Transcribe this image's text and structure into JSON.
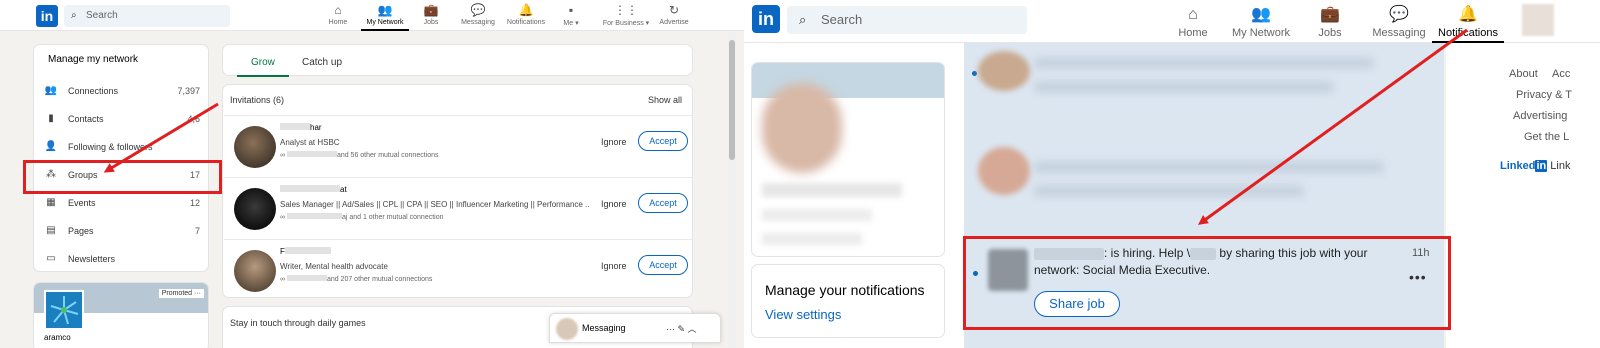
{
  "left": {
    "nav": {
      "logo": "in",
      "search_placeholder": "Search",
      "items": [
        {
          "label": "Home",
          "icon": "home-icon",
          "glyph": "⌂"
        },
        {
          "label": "My Network",
          "icon": "network-icon",
          "glyph": "👥"
        },
        {
          "label": "Jobs",
          "icon": "briefcase-icon",
          "glyph": "💼"
        },
        {
          "label": "Messaging",
          "icon": "message-icon",
          "glyph": "💬"
        },
        {
          "label": "Notifications",
          "icon": "bell-icon",
          "glyph": "🔔"
        },
        {
          "label": "Me ▾",
          "icon": "avatar-icon",
          "glyph": "▪"
        },
        {
          "label": "For Business ▾",
          "icon": "grid-icon",
          "glyph": "⋮⋮"
        },
        {
          "label": "Advertise",
          "icon": "advertise-icon",
          "glyph": "↻"
        }
      ]
    },
    "manage": {
      "title": "Manage my network",
      "items": [
        {
          "label": "Connections",
          "count": "7,397",
          "icon": "connections-icon",
          "glyph": "👥"
        },
        {
          "label": "Contacts",
          "count": "4,6",
          "icon": "contacts-icon",
          "glyph": "▮"
        },
        {
          "label": "Following & followers",
          "count": "",
          "icon": "person-icon",
          "glyph": "👤"
        },
        {
          "label": "Groups",
          "count": "17",
          "icon": "groups-icon",
          "glyph": "⁂"
        },
        {
          "label": "Events",
          "count": "12",
          "icon": "calendar-icon",
          "glyph": "▦"
        },
        {
          "label": "Pages",
          "count": "7",
          "icon": "pages-icon",
          "glyph": "▤"
        },
        {
          "label": "Newsletters",
          "count": "",
          "icon": "newsletter-icon",
          "glyph": "▭"
        }
      ]
    },
    "promo": {
      "badge": "Promoted ···",
      "company": "aramco"
    },
    "tabs": [
      "Grow",
      "Catch up"
    ],
    "invitations": {
      "header": "Invitations (6)",
      "show_all": "Show all",
      "ignore": "Ignore",
      "accept": "Accept",
      "rows": [
        {
          "name": "har",
          "title": "Analyst at HSBC",
          "mutual": "and 56 other mutual connections"
        },
        {
          "name": "at",
          "title": "Sales Manager || Ad/Sales || CPL || CPA || SEO || Influencer Marketing || Performance ...",
          "mutual": "aj and 1 other mutual connection"
        },
        {
          "name": "F",
          "title": "Writer, Mental health advocate",
          "mutual": "and 207 other mutual connections"
        }
      ]
    },
    "games": "Stay in touch through daily games",
    "messaging": {
      "label": "Messaging",
      "actions": "···  ✎  ︿"
    }
  },
  "right": {
    "nav": {
      "logo": "in",
      "search_placeholder": "Search",
      "items": [
        {
          "label": "Home",
          "icon": "home-icon",
          "glyph": "⌂"
        },
        {
          "label": "My Network",
          "icon": "network-icon",
          "glyph": "👥"
        },
        {
          "label": "Jobs",
          "icon": "briefcase-icon",
          "glyph": "💼"
        },
        {
          "label": "Messaging",
          "icon": "message-icon",
          "glyph": "💬"
        },
        {
          "label": "Notifications",
          "icon": "bell-icon",
          "glyph": "🔔"
        }
      ]
    },
    "manage_notifications": {
      "title": "Manage your notifications",
      "link": "View settings"
    },
    "notification": {
      "text_a": ": is hiring. Help \\",
      "text_b": "by sharing this job with your network: Social Media Executive.",
      "time": "11h",
      "button": "Share job",
      "more": "•••"
    },
    "footer_links": [
      "About",
      "Acc",
      "Privacy & T",
      "Advertising",
      "Get the L"
    ],
    "footer_brand": "Linked",
    "footer_brand_in": "in",
    "footer_brand_tail": " Link"
  }
}
